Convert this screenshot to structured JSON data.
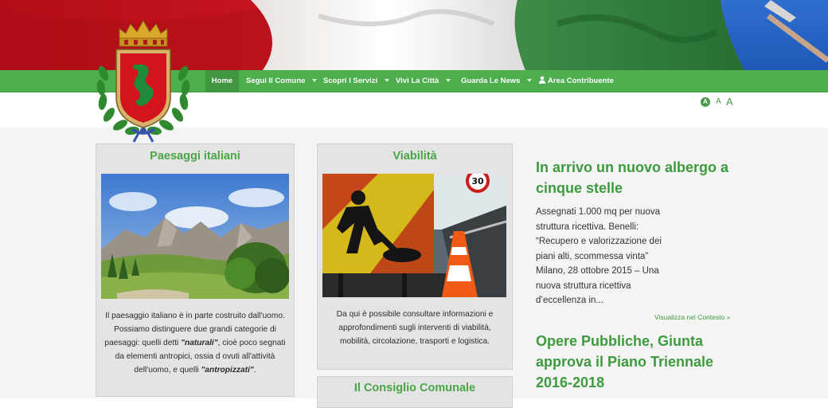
{
  "nav": {
    "items": [
      {
        "label": "Home",
        "active": true
      },
      {
        "label": "Segui Il Comune",
        "dropdown": true
      },
      {
        "label": "Scopri I Servizi",
        "dropdown": true
      },
      {
        "label": "Vivi La Città",
        "dropdown": true
      },
      {
        "label": "Guarda Le News",
        "dropdown": true
      }
    ],
    "contributor_label": "Area Contribuente"
  },
  "font_controls": [
    "A",
    "A",
    "A"
  ],
  "cards": {
    "landscapes": {
      "title": "Paesaggi italiani",
      "body_start": "Il paesaggio italiano è in parte costruito dall'uomo. Possiamo distinguere due grandi categorie di paesaggi: quelli detti ",
      "term_natural": "\"naturali\"",
      "body_middle": ", cioè poco segnati da elementi antropici, ossia d ovuti all'attività dell'uomo, e quelli ",
      "term_anthropized": "\"antropizzati\"",
      "body_end": "."
    },
    "roads": {
      "title": "Viabilità",
      "body": "Da qui è possibile consultare informazioni e approfondimenti sugli interventi di viabilità, mobilità, circolazione, trasporti e logistica.",
      "sign_text": "30"
    },
    "council": {
      "title": "Il Consiglio Comunale"
    }
  },
  "news": [
    {
      "title": "In arrivo un nuovo albergo a cinque stelle",
      "excerpt": "Assegnati 1.000 mq per nuova struttura ricettiva. Benelli: “Recupero e valorizzazione dei piani alti, scommessa vinta” Milano, 28 ottobre 2015 – Una nuova struttura ricettiva d’eccellenza in...",
      "link": "Visualizza nel Contesto »"
    },
    {
      "title": "Opere Pubbliche, Giunta approva il Piano Triennale 2016-2018"
    }
  ],
  "colors": {
    "nav_green": "#4cae4c",
    "heading_green": "#3e9a3e",
    "flag_red": "#c8121e",
    "flag_green": "#2e8a3a"
  }
}
